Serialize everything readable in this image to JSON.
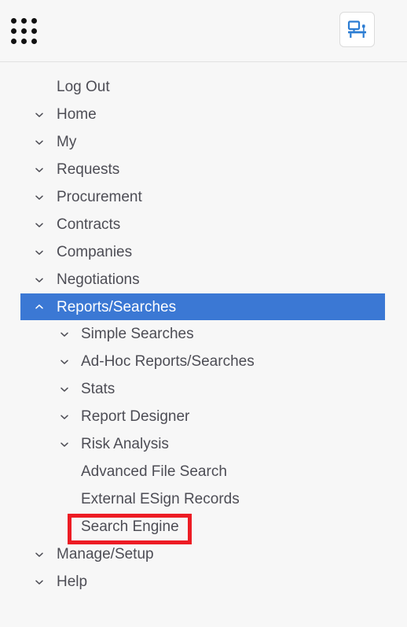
{
  "header": {
    "app_grid_icon": "grid-apps-icon",
    "workstation_icon": "workstation-monitor-desk-icon"
  },
  "theme": {
    "page_background": "#f7f7f7",
    "text_color": "#4d4d55",
    "selected_background": "#3b78d4",
    "selected_text": "#ffffff",
    "annotation_color": "#ed1c24",
    "icon_accent": "#2b7cd3",
    "divider_color": "#e2e2e2"
  },
  "nav": {
    "items": [
      {
        "label": "Log Out",
        "level": 1,
        "chevron": "none",
        "state": "normal"
      },
      {
        "label": "Home",
        "level": 1,
        "chevron": "down",
        "state": "normal"
      },
      {
        "label": "My",
        "level": 1,
        "chevron": "down",
        "state": "normal"
      },
      {
        "label": "Requests",
        "level": 1,
        "chevron": "down",
        "state": "normal"
      },
      {
        "label": "Procurement",
        "level": 1,
        "chevron": "down",
        "state": "normal"
      },
      {
        "label": "Contracts",
        "level": 1,
        "chevron": "down",
        "state": "normal"
      },
      {
        "label": "Companies",
        "level": 1,
        "chevron": "down",
        "state": "normal"
      },
      {
        "label": "Negotiations",
        "level": 1,
        "chevron": "down",
        "state": "normal"
      },
      {
        "label": "Reports/Searches",
        "level": 1,
        "chevron": "up",
        "state": "selected"
      },
      {
        "label": "Simple Searches",
        "level": 2,
        "chevron": "down",
        "state": "normal"
      },
      {
        "label": "Ad-Hoc Reports/Searches",
        "level": 2,
        "chevron": "down",
        "state": "normal"
      },
      {
        "label": "Stats",
        "level": 2,
        "chevron": "down",
        "state": "normal"
      },
      {
        "label": "Report Designer",
        "level": 2,
        "chevron": "down",
        "state": "normal"
      },
      {
        "label": "Risk Analysis",
        "level": 2,
        "chevron": "down",
        "state": "normal"
      },
      {
        "label": "Advanced File Search",
        "level": 2,
        "chevron": "none",
        "state": "normal"
      },
      {
        "label": "External ESign Records",
        "level": 2,
        "chevron": "none",
        "state": "normal"
      },
      {
        "label": "Search Engine",
        "level": 2,
        "chevron": "none",
        "state": "annotated"
      },
      {
        "label": "Manage/Setup",
        "level": 1,
        "chevron": "down",
        "state": "normal"
      },
      {
        "label": "Help",
        "level": 1,
        "chevron": "down",
        "state": "normal"
      }
    ]
  }
}
